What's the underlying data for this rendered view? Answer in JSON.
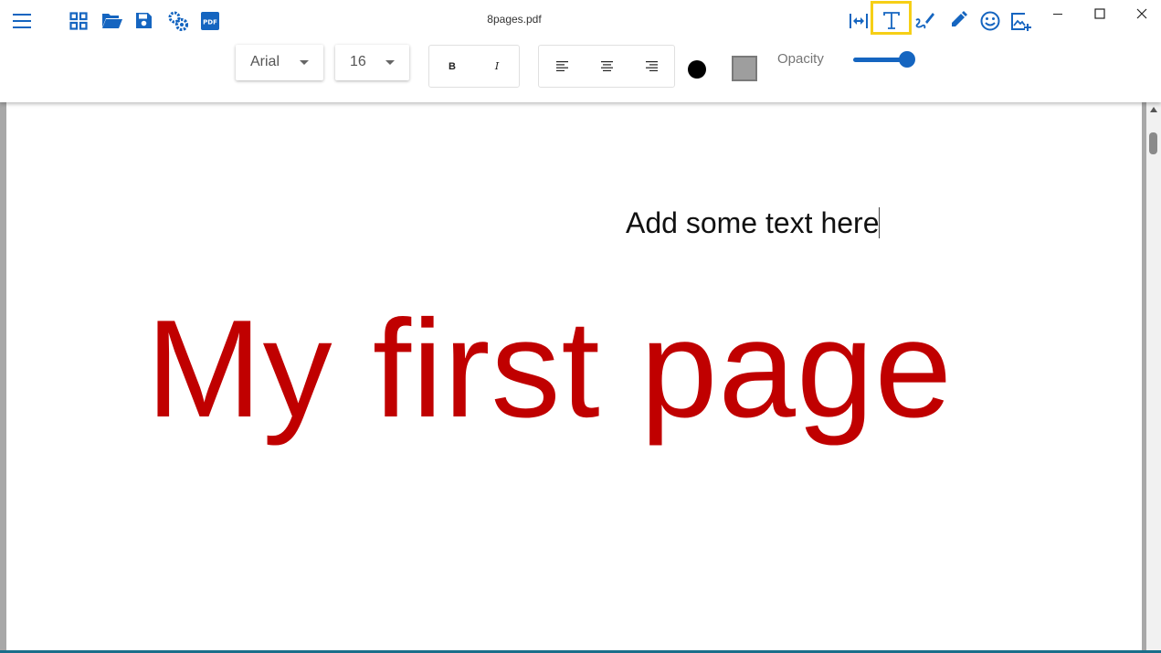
{
  "window": {
    "title": "8pages.pdf"
  },
  "format_bar": {
    "font_family": "Arial",
    "font_size": "16",
    "bold_label": "B",
    "italic_label": "I",
    "opacity_label": "Opacity",
    "opacity_value": 0.85
  },
  "document": {
    "text_box": "Add some text here",
    "heading": "My first page"
  },
  "colors": {
    "accent": "#1565c0",
    "heading": "#c00000",
    "highlight": "#f6cf16",
    "text_color": "#000000",
    "background_swatch": "#9e9e9e"
  },
  "icons": {
    "menu": "menu-icon",
    "grid": "grid-icon",
    "open": "folder-open-icon",
    "save": "save-icon",
    "settings": "settings-icon",
    "pdf": "pdf-icon",
    "fit_width": "fit-width-icon",
    "text_tool": "text-tool-icon",
    "signature": "signature-icon",
    "pen": "pen-icon",
    "emoji": "emoji-icon",
    "add_image": "add-image-icon"
  }
}
